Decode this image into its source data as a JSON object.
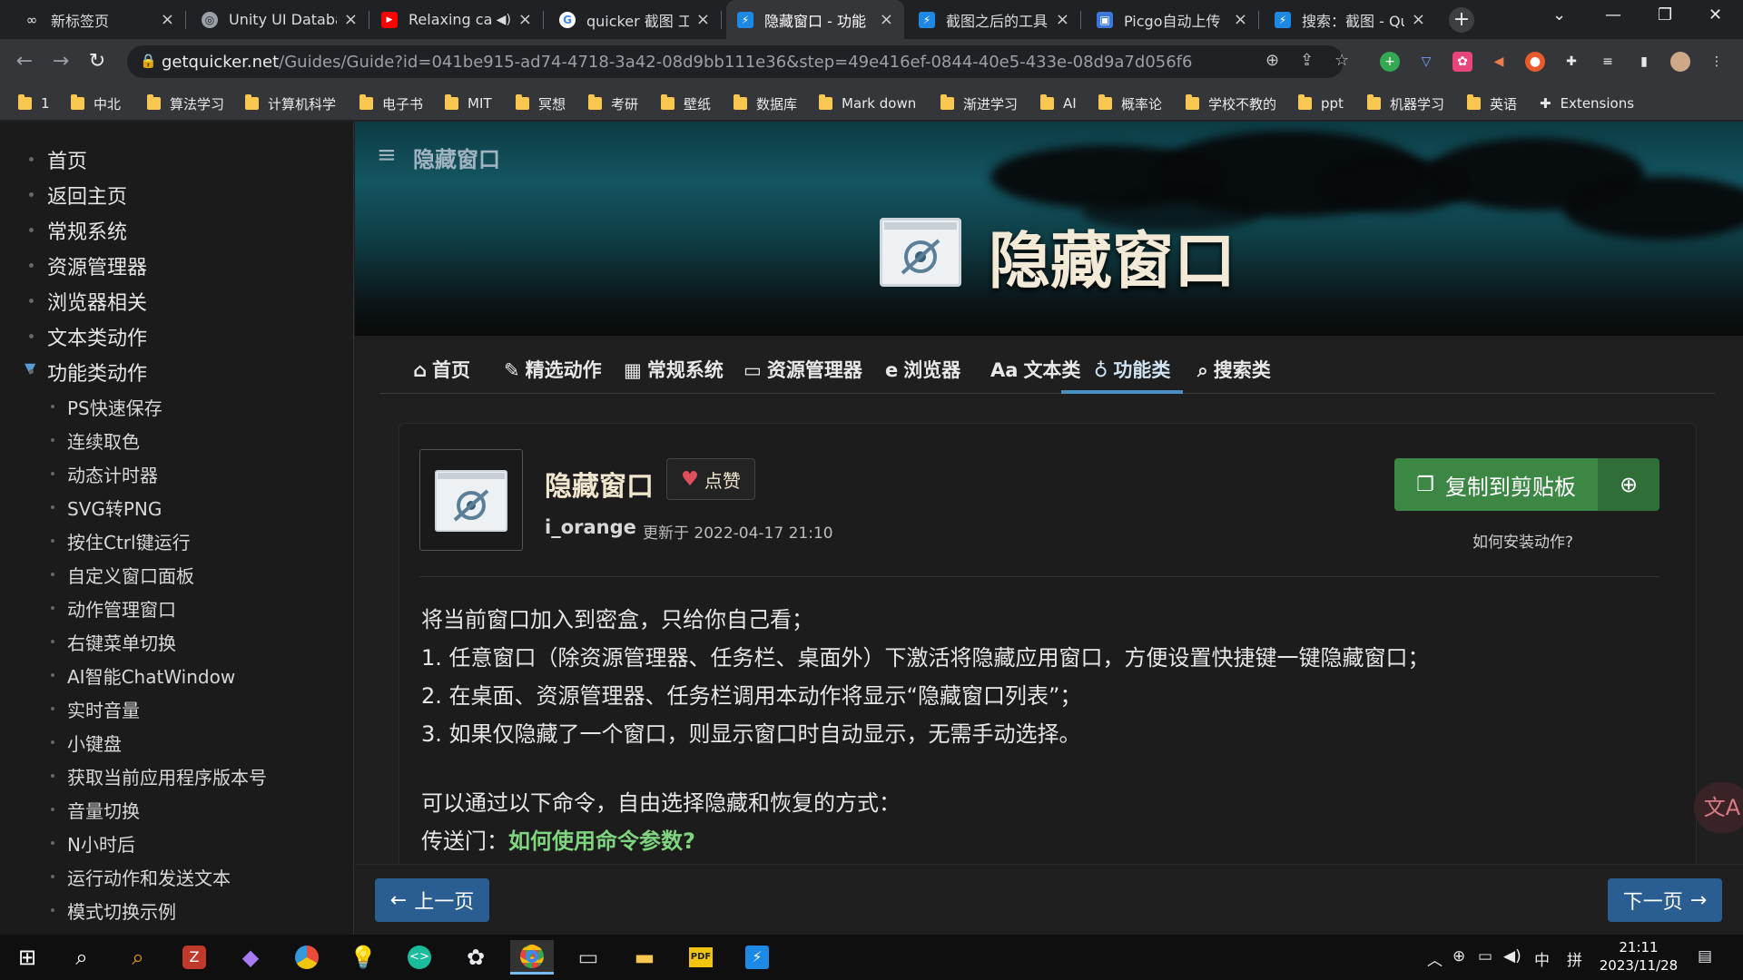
{
  "browser": {
    "tabs": [
      {
        "title": "新标签页",
        "icon": "infinity-icon"
      },
      {
        "title": "Unity UI Databa",
        "icon": "chatgpt-icon"
      },
      {
        "title": "Relaxing ca",
        "icon": "youtube-icon"
      },
      {
        "title": "quicker 截图 工",
        "icon": "google-icon"
      },
      {
        "title": "隐藏窗口 - 功能",
        "icon": "quicker-icon",
        "active": true
      },
      {
        "title": "截图之后的工具",
        "icon": "quicker-icon"
      },
      {
        "title": "Picgo自动上传",
        "icon": "picgo-icon"
      },
      {
        "title": "搜索：截图 - Qu",
        "icon": "quicker-icon"
      }
    ],
    "url_host": "getquicker.net",
    "url_path": "/Guides/Guide?id=041be915-ad74-4718-3a42-08d9bb111e36&step=49e416ef-0844-40e5-433e-08d9a7d056f6",
    "bookmarks": [
      "1",
      "中北",
      "算法学习",
      "计算机科学",
      "电子书",
      "MIT",
      "冥想",
      "考研",
      "壁纸",
      "数据库",
      "Mark down",
      "渐进学习",
      "AI",
      "概率论",
      "学校不教的",
      "ppt",
      "机器学习",
      "英语"
    ],
    "extensions_label": "Extensions"
  },
  "sidebar": {
    "items": [
      "首页",
      "返回主页",
      "常规系统",
      "资源管理器",
      "浏览器相关",
      "文本类动作",
      "功能类动作"
    ],
    "subitems": [
      "PS快速保存",
      "连续取色",
      "动态计时器",
      "SVG转PNG",
      "按住Ctrl键运行",
      "自定义窗口面板",
      "动作管理窗口",
      "右键菜单切换",
      "AI智能ChatWindow",
      "实时音量",
      "小键盘",
      "获取当前应用程序版本号",
      "音量切换",
      "N小时后",
      "运行动作和发送文本",
      "模式切换示例",
      "……"
    ]
  },
  "hero": {
    "bar_title": "隐藏窗口",
    "title": "隐藏窗口"
  },
  "navtabs": [
    {
      "icon": "home-icon",
      "glyph": "⌂",
      "label": "首页"
    },
    {
      "icon": "magic-wand-icon",
      "glyph": "✎",
      "label": "精选动作"
    },
    {
      "icon": "windows-icon",
      "glyph": "▦",
      "label": "常规系统"
    },
    {
      "icon": "folder-open-icon",
      "glyph": "▭",
      "label": "资源管理器"
    },
    {
      "icon": "edge-icon",
      "glyph": "e",
      "label": "浏览器"
    },
    {
      "icon": "font-icon",
      "glyph": "Aa",
      "label": "文本类"
    },
    {
      "icon": "flask-icon",
      "glyph": "♁",
      "label": "功能类"
    },
    {
      "icon": "search-icon",
      "glyph": "⌕",
      "label": "搜索类"
    }
  ],
  "action": {
    "name": "隐藏窗口",
    "like_label": "点赞",
    "author": "i_orange",
    "updated": "更新于 2022-04-17 21:10",
    "copy_label": "复制到剪贴板",
    "howto": "如何安装动作?",
    "desc": [
      "将当前窗口加入到密盒，只给你自己看；",
      "1. 任意窗口（除资源管理器、任务栏、桌面外）下激活将隐藏应用窗口，方便设置快捷键一键隐藏窗口；",
      "2. 在桌面、资源管理器、任务栏调用本动作将显示“隐藏窗口列表”；",
      "3. 如果仅隐藏了一个窗口，则显示窗口时自动显示，无需手动选择。"
    ],
    "cmd_intro": "可以通过以下命令，自由选择隐藏和恢复的方式：",
    "portal_label": "传送门：",
    "portal_link": "如何使用命令参数?"
  },
  "pager": {
    "prev": "上一页",
    "next": "下一页"
  },
  "taskbar": {
    "ime_lang": "中",
    "ime_mode": "拼",
    "time": "21:11",
    "date": "2023/11/28"
  }
}
